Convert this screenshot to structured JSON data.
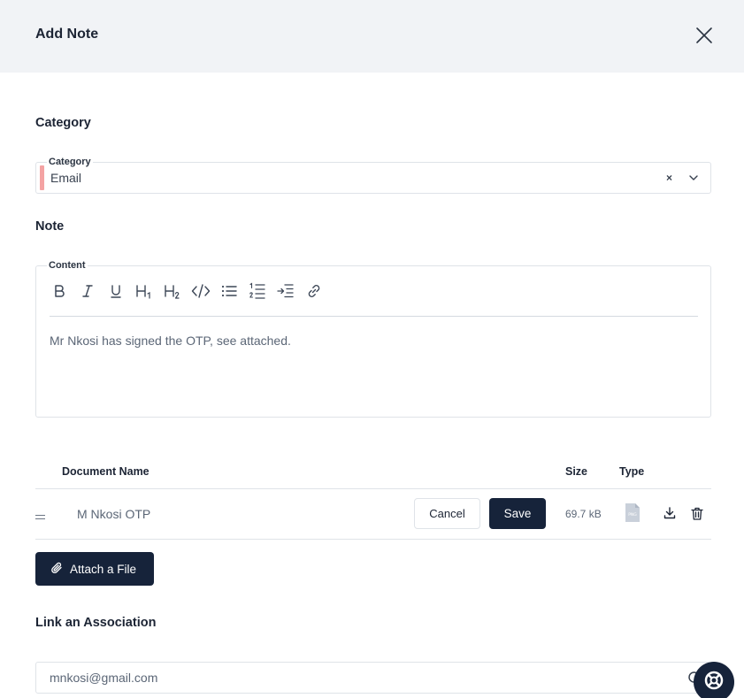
{
  "header": {
    "title": "Add Note"
  },
  "category_section": {
    "heading": "Category",
    "field_label": "Category",
    "value": "Email",
    "clear_symbol": "×"
  },
  "note_section": {
    "heading": "Note",
    "field_label": "Content",
    "toolbar": [
      "bold-icon",
      "italic-icon",
      "underline-icon",
      "heading1-icon",
      "heading2-icon",
      "code-icon",
      "bullet-list-icon",
      "ordered-list-icon",
      "indent-icon",
      "link-icon"
    ],
    "content": "Mr Nkosi has signed the OTP, see attached."
  },
  "documents": {
    "columns": {
      "name": "Document Name",
      "size": "Size",
      "type": "Type"
    },
    "rows": [
      {
        "name": "M Nkosi OTP",
        "size": "69.7 kB",
        "type_icon": "png-file-icon",
        "cancel_label": "Cancel",
        "save_label": "Save"
      }
    ],
    "attach_label": "Attach a File"
  },
  "association": {
    "heading": "Link an Association",
    "value": "mnkosi@gmail.com"
  },
  "colors": {
    "primary": "#16233a",
    "accent": "#f4a3a3",
    "header_bg": "#f1f3f6"
  }
}
